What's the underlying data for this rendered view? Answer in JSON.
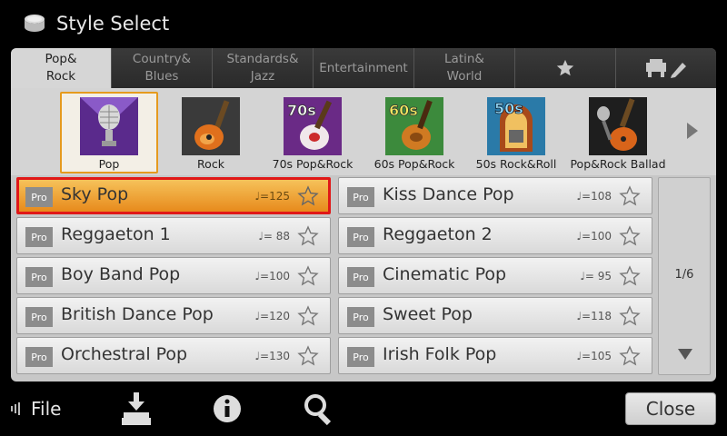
{
  "window": {
    "title": "Style Select"
  },
  "tabs": [
    {
      "label": "Pop&\nRock",
      "active": true
    },
    {
      "label": "Country&\nBlues",
      "active": false
    },
    {
      "label": "Standards&\nJazz",
      "active": false
    },
    {
      "label": "Entertainment",
      "active": false
    },
    {
      "label": "Latin&\nWorld",
      "active": false
    },
    {
      "icon": "star-icon",
      "active": false
    },
    {
      "icon": "user-edit-icon",
      "active": false
    }
  ],
  "categories": [
    {
      "label": "Pop",
      "icon": "microphone-icon",
      "selected": true
    },
    {
      "label": "Rock",
      "icon": "guitar-icon",
      "selected": false
    },
    {
      "label": "70s Pop&Rock",
      "icon": "guitar-70s-icon",
      "badge": "70s",
      "selected": false
    },
    {
      "label": "60s Pop&Rock",
      "icon": "guitar-60s-icon",
      "badge": "60s",
      "selected": false
    },
    {
      "label": "50s Rock&Roll",
      "icon": "jukebox-50s-icon",
      "badge": "50s",
      "selected": false
    },
    {
      "label": "Pop&Rock Ballad",
      "icon": "mic-guitar-icon",
      "selected": false
    }
  ],
  "styles": [
    {
      "badge": "Pro",
      "name": "Sky Pop",
      "tempo": "♩=125",
      "selected": true
    },
    {
      "badge": "Pro",
      "name": "Kiss Dance Pop",
      "tempo": "♩=108",
      "selected": false
    },
    {
      "badge": "Pro",
      "name": "Reggaeton 1",
      "tempo": "♩= 88",
      "selected": false
    },
    {
      "badge": "Pro",
      "name": "Reggaeton 2",
      "tempo": "♩=100",
      "selected": false
    },
    {
      "badge": "Pro",
      "name": "Boy Band Pop",
      "tempo": "♩=100",
      "selected": false
    },
    {
      "badge": "Pro",
      "name": "Cinematic Pop",
      "tempo": "♩= 95",
      "selected": false
    },
    {
      "badge": "Pro",
      "name": "British Dance Pop",
      "tempo": "♩=120",
      "selected": false
    },
    {
      "badge": "Pro",
      "name": "Sweet Pop",
      "tempo": "♩=118",
      "selected": false
    },
    {
      "badge": "Pro",
      "name": "Orchestral Pop",
      "tempo": "♩=130",
      "selected": false
    },
    {
      "badge": "Pro",
      "name": "Irish Folk Pop",
      "tempo": "♩=105",
      "selected": false
    }
  ],
  "pager": {
    "page": "1/6"
  },
  "bottom": {
    "file_label": "File",
    "icons": [
      "save-icon",
      "info-icon",
      "search-icon"
    ],
    "close_label": "Close"
  },
  "colors": {
    "accent": "#e59a1e",
    "selection_border": "#e01818",
    "selected_row": "#f0a83a"
  }
}
